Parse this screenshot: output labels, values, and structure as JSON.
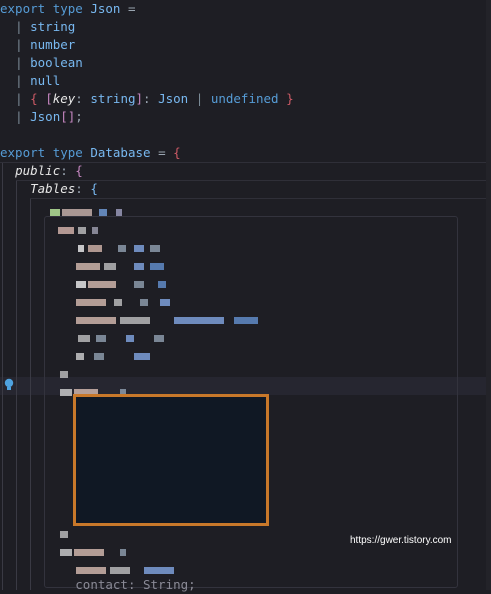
{
  "code": {
    "line1": {
      "export": "export",
      "type": "type",
      "name": "Json",
      "eq": "="
    },
    "line2": {
      "pipe": "|",
      "t": "string"
    },
    "line3": {
      "pipe": "|",
      "t": "number"
    },
    "line4": {
      "pipe": "|",
      "t": "boolean"
    },
    "line5": {
      "pipe": "|",
      "t": "null"
    },
    "line6": {
      "pipe": "|",
      "open": "{",
      "lb": "[",
      "key": "key",
      "colon": ":",
      "kt": "string",
      "rb": "]",
      "colon2": ":",
      "t1": "Json",
      "bar": "|",
      "t2": "undefined",
      "close": "}"
    },
    "line7": {
      "pipe": "|",
      "t": "Json",
      "arr": "[]",
      "semi": ";"
    },
    "line9": {
      "export": "export",
      "type": "type",
      "name": "Database",
      "eq": "=",
      "open": "{"
    },
    "line10": {
      "prop": "public",
      "colon": ":",
      "open": "{"
    },
    "line11": {
      "prop": "Tables",
      "colon": ":",
      "open": "{"
    },
    "line_bottom": {
      "text": "contact: String;"
    }
  },
  "watermark": "https://gwer.tistory.com",
  "colors": {
    "background": "#1e1e24",
    "keyword": "#569cd6",
    "type": "#78b8f0",
    "highlight_border": "#c8782a"
  },
  "icons": [
    "lightbulb-icon"
  ]
}
